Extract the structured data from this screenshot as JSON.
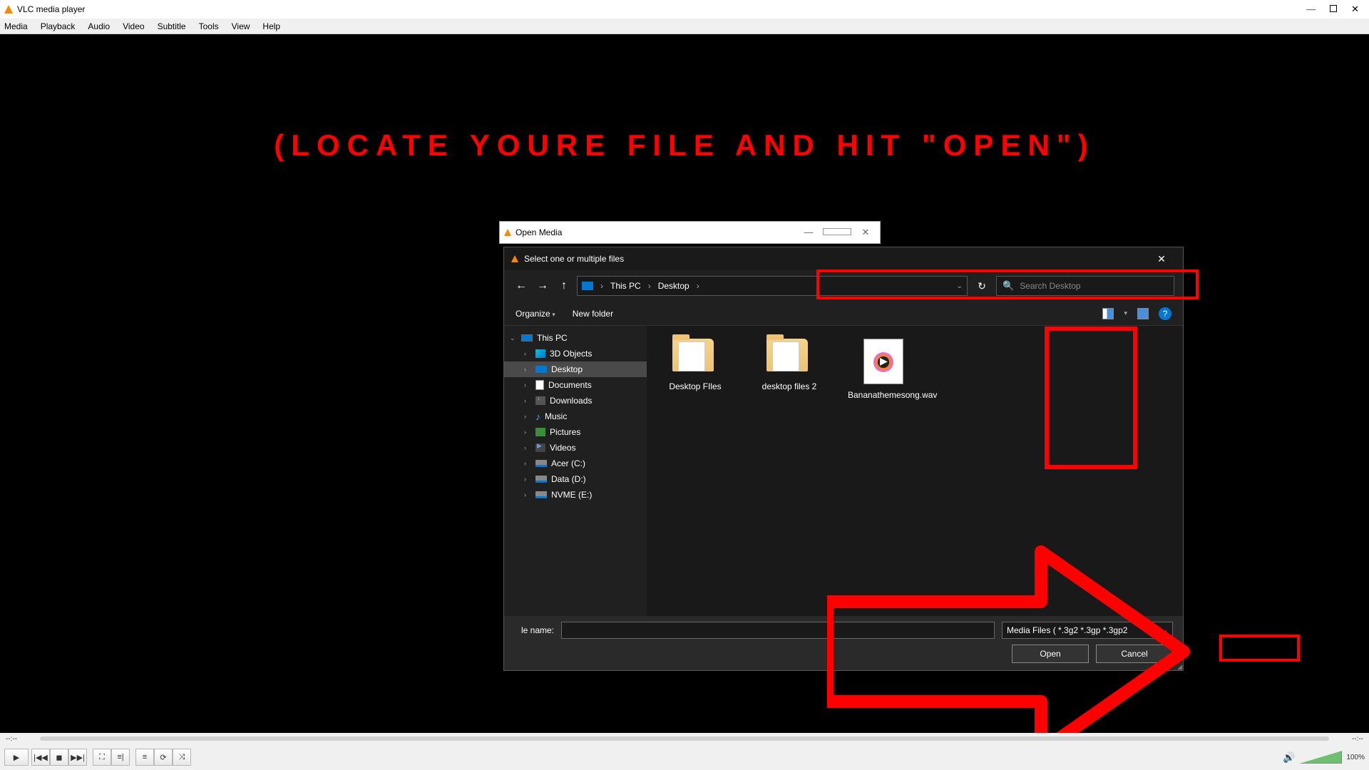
{
  "app": {
    "title": "VLC media player",
    "menus": [
      "Media",
      "Playback",
      "Audio",
      "Video",
      "Subtitle",
      "Tools",
      "View",
      "Help"
    ]
  },
  "instruction": "(LOCATE YOURE FILE AND HIT \"OPEN\")",
  "open_media": {
    "title": "Open Media"
  },
  "file_picker": {
    "title": "Select one or multiple files",
    "breadcrumb": {
      "item1": "This PC",
      "item2": "Desktop"
    },
    "search_placeholder": "Search Desktop",
    "toolbar": {
      "organize": "Organize",
      "new_folder": "New folder",
      "help": "?"
    },
    "tree": {
      "this_pc": "This PC",
      "items": [
        "3D Objects",
        "Desktop",
        "Documents",
        "Downloads",
        "Music",
        "Pictures",
        "Videos",
        "Acer (C:)",
        "Data (D:)",
        "NVME (E:)"
      ]
    },
    "files": [
      {
        "label": "Desktop FIles"
      },
      {
        "label": "desktop files 2"
      },
      {
        "label": "Bananathemesong.wav"
      }
    ],
    "bottom": {
      "file_name_label": "le name:",
      "filter_label": "Media Files ( *.3g2 *.3gp *.3gp2",
      "open_label": "Open",
      "cancel_label": "Cancel"
    }
  },
  "seek": {
    "left": "--:--",
    "right": "--:--"
  },
  "volume": {
    "pct": "100%"
  }
}
